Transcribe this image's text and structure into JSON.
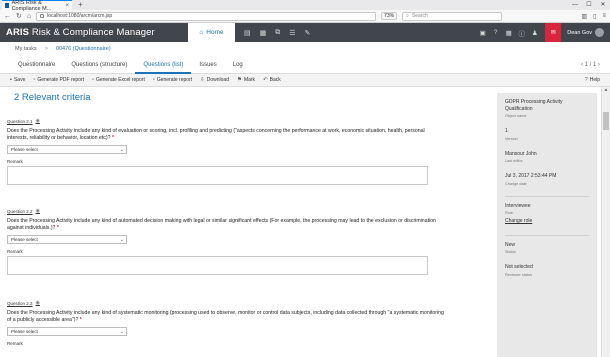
{
  "browser": {
    "tab_title": "ARIS Risk & Compliance M...",
    "tab_close": "×",
    "new_tab": "+",
    "url": "localhost:1080/arcm/arcm.jsp",
    "zoom": "73%",
    "search_placeholder": "Search",
    "win_min": "—",
    "win_max": "☐",
    "win_close": "✕"
  },
  "header": {
    "title_bold": "ARIS",
    "title_rest": " Risk & Compliance Manager",
    "home_label": "Home",
    "user_name": "Dean Gov"
  },
  "breadcrumb": {
    "root": "My tasks",
    "sep": ">",
    "current": "00476 (Questionnaire)"
  },
  "tabs": {
    "items": [
      "Questionnaire",
      "Questions (structure)",
      "Questions (list)",
      "Issues",
      "Log"
    ],
    "pager": "‹ 1 / 1 ›"
  },
  "toolbar": {
    "items": [
      "Save",
      "Generate PDF report",
      "Generate Excel report",
      "Generate report",
      "Download",
      "Mark",
      "Back"
    ],
    "help": "Help"
  },
  "main": {
    "heading": "2 Relevant criteria",
    "questions": [
      {
        "label": "Question 2.1",
        "text": "Does the Processing Activity include any kind of evaluation or scoring, incl. profiling and predicting (\"aspects concerning the performance at work, economic situation, health, personal interests, reliability or behavior, location etc)?",
        "select": "Please select",
        "remark": "Remark"
      },
      {
        "label": "Question 2.2",
        "text": "Does the Processing Activity include any kind of automated decision making with legal or similar significant effects (For example, the processing may lead to the exclusion or discrimination against individuals.)?",
        "select": "Please select",
        "remark": "Remark"
      },
      {
        "label": "Question 2.3",
        "text": "Does the Processing Activity include any kind of systematic monitoring (processing used to observe, monitor or control data subjects, including data collected through \"a systematic monitoring of a publicly accessible area\")?",
        "select": "Please select",
        "remark": "Remark"
      }
    ]
  },
  "panel": {
    "object_name": "GDPR Processing Activity Qualification",
    "object_name_label": "Object name",
    "version": "1",
    "version_label": "Version",
    "last_editor": "Mansour John",
    "last_editor_label": "Last editor",
    "change_date": "Jul 3, 2017 2:53:44 PM",
    "change_date_label": "Change date",
    "role": "Interviewee",
    "role_label": "Role",
    "change_role": "Change role",
    "status": "New",
    "status_label": "Status",
    "reviewer_status": "Not selected",
    "reviewer_status_label": "Reviewer status"
  }
}
